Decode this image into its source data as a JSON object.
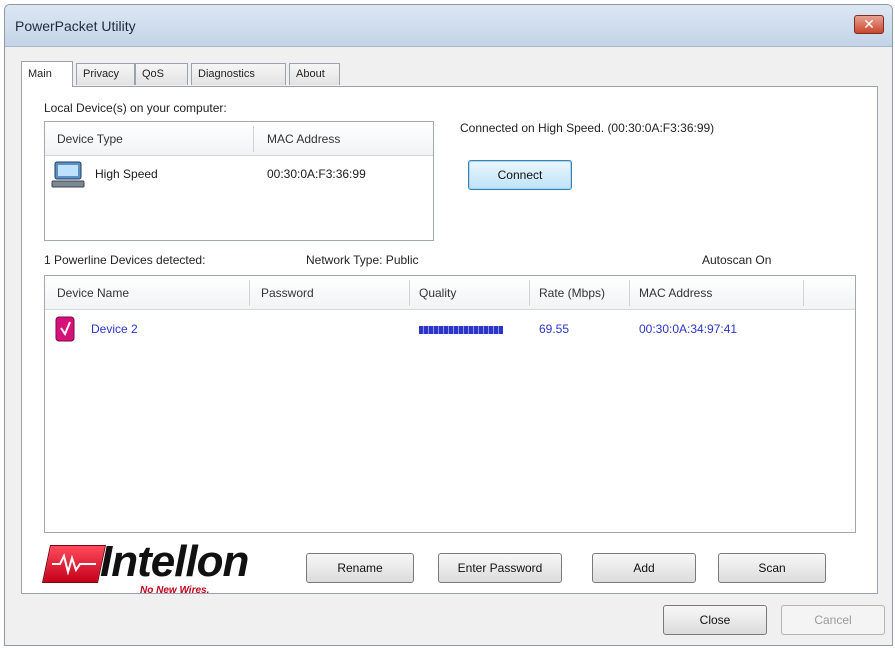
{
  "window": {
    "title": "PowerPacket Utility"
  },
  "tabs": [
    "Main",
    "Privacy",
    "QoS",
    "Diagnostics",
    "About"
  ],
  "local": {
    "label": "Local Device(s) on your computer:",
    "headers": [
      "Device Type",
      "MAC Address"
    ],
    "row": {
      "type": "High Speed",
      "mac": "00:30:0A:F3:36:99",
      "icon": "computer-icon"
    }
  },
  "connection": {
    "status": "Connected on High Speed. (00:30:0A:F3:36:99)",
    "connect_label": "Connect"
  },
  "powerline": {
    "detected": "1 Powerline Devices detected:",
    "network_type": "Network Type: Public",
    "autoscan": "Autoscan On",
    "headers": [
      "Device Name",
      "Password",
      "Quality",
      "Rate (Mbps)",
      "MAC Address"
    ],
    "rows": [
      {
        "name": "Device 2",
        "password": "",
        "quality": 1.0,
        "rate": "69.55",
        "mac": "00:30:0A:34:97:41",
        "icon": "powerline-adapter-icon"
      }
    ]
  },
  "logo": {
    "name": "Intellon",
    "tagline": "No New Wires."
  },
  "actions": {
    "rename": "Rename",
    "enter_password": "Enter Password",
    "add": "Add",
    "scan": "Scan"
  },
  "footer": {
    "close": "Close",
    "cancel": "Cancel"
  },
  "colors": {
    "link_text": "#2b35c8",
    "quality_bar": "#2b35c8",
    "logo_red": "#c4001a"
  }
}
